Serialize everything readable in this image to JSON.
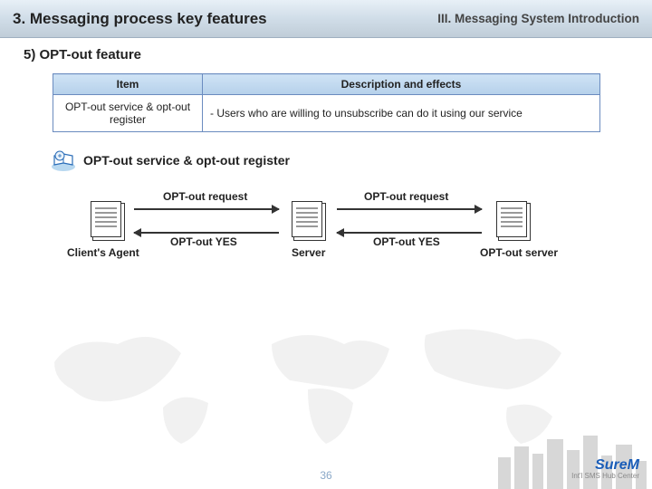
{
  "header": {
    "title_left": "3. Messaging process key features",
    "title_right": "III. Messaging System Introduction"
  },
  "subheading": "5) OPT-out feature",
  "table": {
    "col1_header": "Item",
    "col2_header": "Description and effects",
    "row1_item": "OPT-out service & opt-out register",
    "row1_desc": "- Users who are willing to unsubscribe can do it using our service"
  },
  "section": {
    "label": "OPT-out service & opt-out register"
  },
  "diagram": {
    "node1": "Client's Agent",
    "node2": "Server",
    "node3": "OPT-out server",
    "req1": "OPT-out request",
    "yes1": "OPT-out YES",
    "req2": "OPT-out request",
    "yes2": "OPT-out YES"
  },
  "page_number": "36",
  "logo": {
    "brand": "SureM",
    "tagline": "Int'l SMS Hub Center"
  }
}
